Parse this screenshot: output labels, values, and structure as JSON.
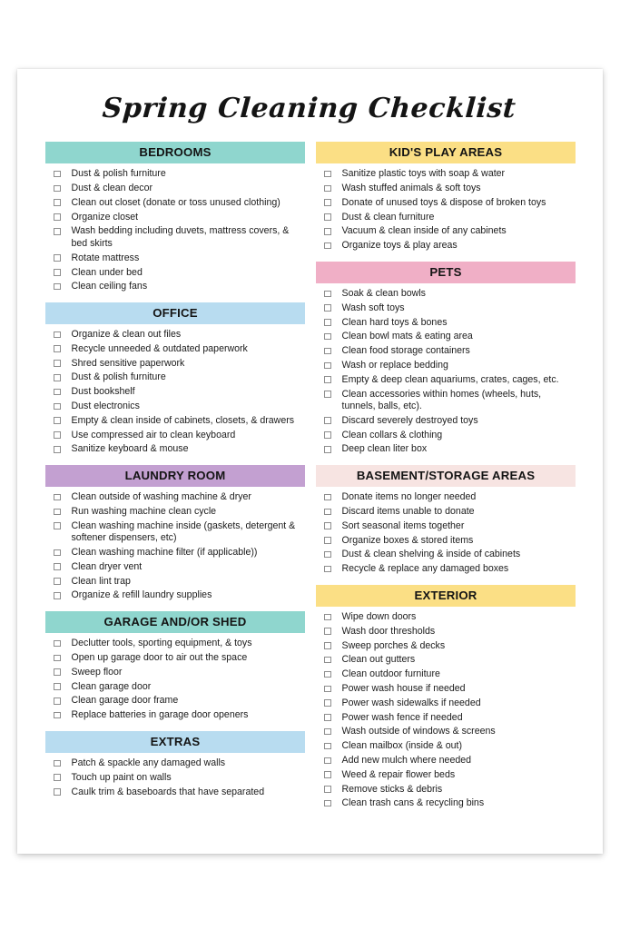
{
  "page": {
    "title": "Spring Cleaning Checklist"
  },
  "colors": {
    "teal": "#8FD6CE",
    "blue": "#B8DCF0",
    "purple": "#C3A0D1",
    "yellow": "#FBDF85",
    "pink": "#F0AFC6",
    "light_pink": "#F7E4E2",
    "checkbox_border": "#8d8d8d",
    "text": "#1b1b1b"
  },
  "left_column": [
    {
      "header": "BEDROOMS",
      "color": "#8FD6CE",
      "items": [
        "Dust & polish furniture",
        "Dust & clean decor",
        "Clean out closet (donate or toss unused clothing)",
        "Organize closet",
        "Wash bedding including duvets, mattress covers, & bed skirts",
        "Rotate mattress",
        "Clean under bed",
        "Clean ceiling fans"
      ]
    },
    {
      "header": "OFFICE",
      "color": "#B8DCF0",
      "items": [
        "Organize & clean out files",
        "Recycle unneeded & outdated paperwork",
        "Shred sensitive paperwork",
        "Dust & polish furniture",
        "Dust bookshelf",
        "Dust electronics",
        "Empty & clean inside of cabinets, closets, & drawers",
        "Use compressed air to clean keyboard",
        "Sanitize keyboard & mouse"
      ]
    },
    {
      "header": "LAUNDRY ROOM",
      "color": "#C3A0D1",
      "items": [
        "Clean outside of washing machine & dryer",
        "Run washing machine clean cycle",
        "Clean washing machine inside (gaskets, detergent & softener dispensers, etc)",
        "Clean washing machine filter (if applicable))",
        "Clean dryer vent",
        "Clean lint trap",
        "Organize & refill laundry supplies"
      ]
    },
    {
      "header": "GARAGE AND/OR SHED",
      "color": "#8FD6CE",
      "items": [
        "Declutter tools, sporting equipment, & toys",
        "Open up garage door to air out the space",
        "Sweep floor",
        "Clean garage door",
        "Clean garage door frame",
        "Replace batteries in garage door openers"
      ]
    },
    {
      "header": "EXTRAS",
      "color": "#B8DCF0",
      "items": [
        "Patch & spackle any damaged walls",
        "Touch up paint on walls",
        "Caulk trim & baseboards that have separated"
      ]
    }
  ],
  "right_column": [
    {
      "header": "KID'S PLAY AREAS",
      "color": "#FBDF85",
      "items": [
        "Sanitize plastic toys with soap & water",
        "Wash stuffed animals & soft toys",
        "Donate of unused toys & dispose of broken toys",
        "Dust & clean furniture",
        "Vacuum & clean inside of any cabinets",
        "Organize toys & play areas"
      ]
    },
    {
      "header": "PETS",
      "color": "#F0AFC6",
      "items": [
        "Soak & clean bowls",
        "Wash soft toys",
        "Clean hard toys & bones",
        "Clean bowl mats & eating area",
        "Clean food storage containers",
        "Wash or replace bedding",
        "Empty & deep clean aquariums, crates, cages, etc.",
        "Clean accessories within homes (wheels, huts, tunnels, balls, etc).",
        "Discard severely destroyed toys",
        "Clean collars & clothing",
        "Deep clean liter box"
      ]
    },
    {
      "header": "BASEMENT/STORAGE AREAS",
      "color": "#F7E4E2",
      "items": [
        "Donate items no longer needed",
        "Discard items unable to donate",
        "Sort seasonal items together",
        "Organize boxes & stored items",
        "Dust & clean shelving & inside of cabinets",
        "Recycle & replace any damaged boxes"
      ]
    },
    {
      "header": "EXTERIOR",
      "color": "#FBDF85",
      "items": [
        "Wipe down doors",
        "Wash door thresholds",
        "Sweep porches & decks",
        "Clean out gutters",
        "Clean outdoor furniture",
        "Power wash house if needed",
        "Power wash sidewalks if needed",
        "Power wash fence if needed",
        "Wash outside of windows & screens",
        "Clean mailbox (inside & out)",
        "Add new mulch where needed",
        "Weed & repair flower beds",
        "Remove sticks & debris",
        "Clean trash cans & recycling bins"
      ]
    }
  ]
}
